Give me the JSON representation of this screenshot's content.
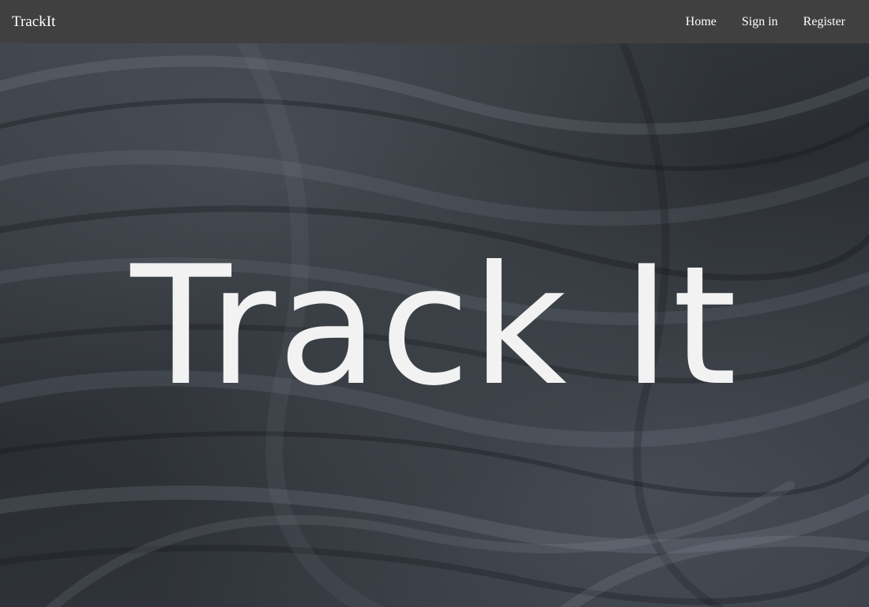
{
  "navbar": {
    "brand": "TrackIt",
    "links": [
      {
        "label": "Home"
      },
      {
        "label": "Sign in"
      },
      {
        "label": "Register"
      }
    ]
  },
  "hero": {
    "title": "Track It"
  },
  "colors": {
    "navbar_bg": "#404040",
    "nav_text": "#ffffff",
    "hero_bg": "#2d3136",
    "hero_text": "#f2f2f2"
  }
}
